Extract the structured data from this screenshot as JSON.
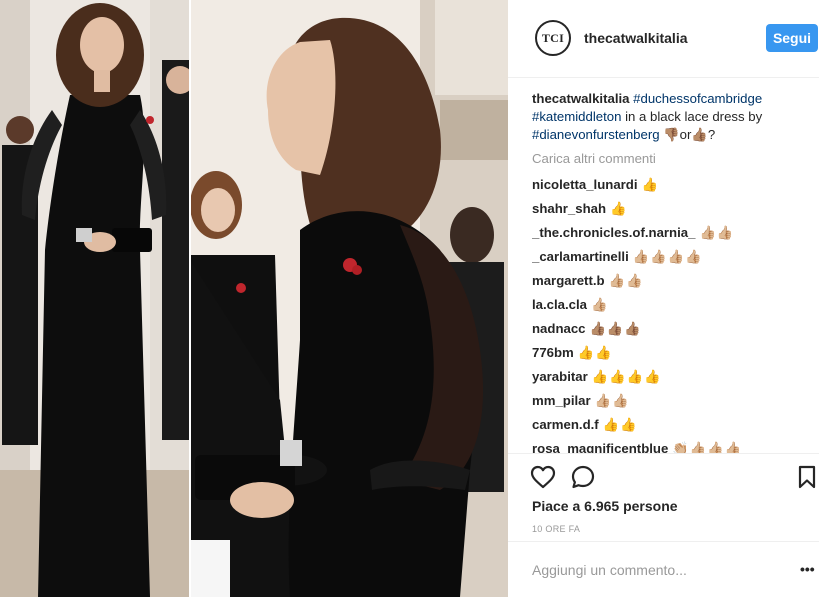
{
  "post": {
    "header": {
      "avatar_text": "TCI",
      "username": "thecatwalkitalia",
      "follow_label": "Segui"
    },
    "caption": {
      "username": "thecatwalkitalia",
      "hashtag_1": "#duchessofcambridge",
      "hashtag_2": "#katemiddleton",
      "text_1": " in a black lace dress by ",
      "hashtag_3": "#dianevonfurstenberg",
      "emoji_dislike": "👎🏽",
      "text_or": "or",
      "emoji_like": "👍🏽",
      "text_end": "?"
    },
    "load_more": "Carica altri commenti",
    "comments": [
      {
        "user": "nicoletta_lunardi",
        "text": "👍"
      },
      {
        "user": "shahr_shah",
        "text": "👍"
      },
      {
        "user": "_the.chronicles.of.narnia_",
        "text": "👍🏼👍🏼"
      },
      {
        "user": "_carlamartinelli",
        "text": "👍🏼👍🏼👍🏼👍🏼"
      },
      {
        "user": "margarett.b",
        "text": "👍🏼👍🏼"
      },
      {
        "user": "la.cla.cla",
        "text": "👍🏼"
      },
      {
        "user": "nadnacc",
        "text": "👍🏽👍🏽👍🏽"
      },
      {
        "user": "776bm",
        "text": "👍👍"
      },
      {
        "user": "yarabitar",
        "text": "👍👍👍👍"
      },
      {
        "user": "mm_pilar",
        "text": "👍🏼👍🏼"
      },
      {
        "user": "carmen.d.f",
        "text": "👍👍"
      },
      {
        "user": "rosa_magnificentblue",
        "text": "👏🏼👍🏼👍🏼👍🏼"
      }
    ],
    "likes_text": "Piace a 6.965 persone",
    "time_text": "10 ORE FA",
    "comment_placeholder": "Aggiungi un commento...",
    "more_label": "•••",
    "icons": {
      "like": "heart-outline-icon",
      "comment": "speech-bubble-icon",
      "save": "bookmark-icon"
    },
    "colors": {
      "follow_bg": "#3897f0",
      "hashtag": "#003569",
      "muted": "#999999"
    }
  }
}
